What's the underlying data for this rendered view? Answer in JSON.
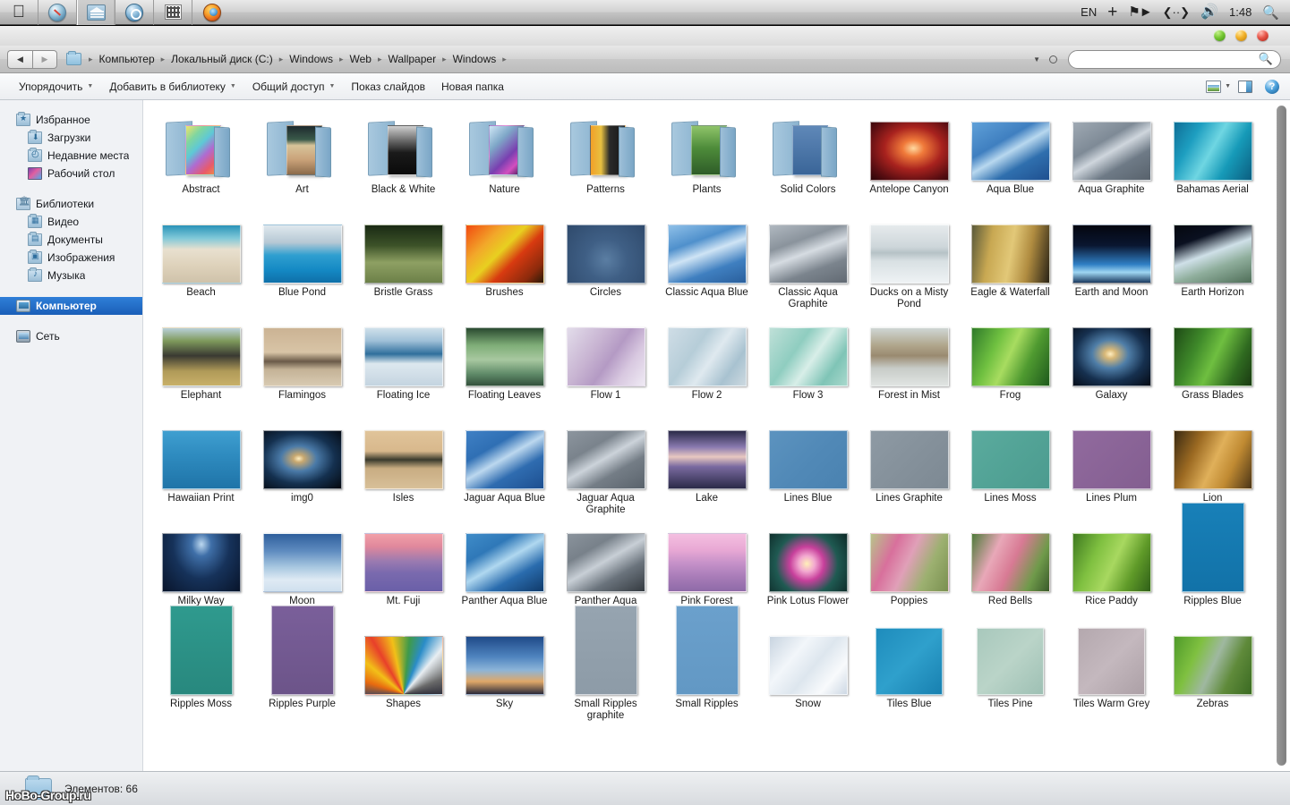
{
  "macbar": {
    "apps": [
      {
        "name": "apple-menu",
        "icon": "apple-icon"
      },
      {
        "name": "safari",
        "icon": "safari-icon"
      },
      {
        "name": "file-manager",
        "icon": "bank-folder-icon"
      },
      {
        "name": "spotlight-app",
        "icon": "blue-globe-icon"
      },
      {
        "name": "qr-app",
        "icon": "qr-code-icon"
      },
      {
        "name": "firefox",
        "icon": "firefox-icon"
      }
    ],
    "status": {
      "input_language": "EN",
      "plus": "+",
      "flag_icon": "flag-icon",
      "network_icon": "network-icon",
      "volume_icon": "volume-icon",
      "clock": "1:48",
      "search_icon": "magnifier-icon"
    }
  },
  "window": {
    "traffic_lights": [
      "green",
      "yellow",
      "red"
    ],
    "colors": {
      "selection": "#1a5fb8",
      "accent": "#2f7fd8"
    }
  },
  "address_bar": {
    "back_label": "◀",
    "forward_label": "▶",
    "folder_icon": "folder-icon",
    "breadcrumbs": [
      "Компьютер",
      "Локальный диск (C:)",
      "Windows",
      "Web",
      "Wallpaper",
      "Windows"
    ],
    "separator": "▸",
    "history_caret": "▼",
    "refresh_icon": "refresh-icon"
  },
  "search": {
    "value": "",
    "placeholder": "",
    "icon": "search-icon"
  },
  "command_bar": {
    "items": [
      {
        "label": "Упорядочить",
        "has_dropdown": true
      },
      {
        "label": "Добавить в библиотеку",
        "has_dropdown": true
      },
      {
        "label": "Общий доступ",
        "has_dropdown": true
      },
      {
        "label": "Показ слайдов",
        "has_dropdown": false
      },
      {
        "label": "Новая папка",
        "has_dropdown": false
      }
    ],
    "right_icons": [
      {
        "name": "change-view-icon"
      },
      {
        "name": "view-dropdown-caret",
        "glyph": "▼"
      },
      {
        "name": "preview-pane-icon"
      },
      {
        "name": "help-icon",
        "glyph": "?"
      }
    ]
  },
  "sidebar": {
    "groups": [
      {
        "header": {
          "label": "Избранное",
          "icon": "favorites-star-icon"
        },
        "items": [
          {
            "label": "Загрузки",
            "icon": "downloads-icon"
          },
          {
            "label": "Недавние места",
            "icon": "recent-places-icon"
          },
          {
            "label": "Рабочий стол",
            "icon": "desktop-icon"
          }
        ]
      },
      {
        "header": {
          "label": "Библиотеки",
          "icon": "libraries-icon"
        },
        "items": [
          {
            "label": "Видео",
            "icon": "video-library-icon"
          },
          {
            "label": "Документы",
            "icon": "documents-library-icon"
          },
          {
            "label": "Изображения",
            "icon": "pictures-library-icon"
          },
          {
            "label": "Музыка",
            "icon": "music-library-icon"
          }
        ]
      },
      {
        "header": {
          "label": "Компьютер",
          "icon": "computer-icon",
          "selected": true
        },
        "items": []
      },
      {
        "header": {
          "label": "Сеть",
          "icon": "network-icon"
        },
        "items": []
      }
    ]
  },
  "status_bar": {
    "icon": "folder-icon",
    "text": "Элементов: 66"
  },
  "watermark": "HoBo-Group.ru",
  "items": [
    {
      "name": "Abstract",
      "type": "folder",
      "thumb": "linear-gradient(135deg,#f0e36a 0%,#7fd6a0 22%,#5ec8d6 40%,#b06ad0 58%,#e85a6a 78%,#f2a03c 100%)"
    },
    {
      "name": "Art",
      "type": "folder",
      "thumb": "linear-gradient(to bottom,#1e2a2e 0%,#3a5a4a 28%,#d8c49a 40%,#c9a178 70%,#8a6a4a 100%)"
    },
    {
      "name": "Black & White",
      "type": "folder",
      "thumb": "linear-gradient(to bottom,#cfcfcf 0%,#6a6a6a 30%,#1a1a1a 55%,#0a0a0a 100%)"
    },
    {
      "name": "Nature",
      "type": "folder",
      "thumb": "linear-gradient(135deg,#cfe6f5 0%,#7fa8c8 30%,#7a3fb0 60%,#d24fc0 78%,#2a1040 100%)"
    },
    {
      "name": "Patterns",
      "type": "folder",
      "thumb": "linear-gradient(to right,#f2a028 0%,#e8c040 30%,#2a2a2a 55%,#151515 100%)"
    },
    {
      "name": "Plants",
      "type": "folder",
      "thumb": "linear-gradient(to bottom,#8fc46a 0%,#4e8c3a 45%,#2e5c28 100%)"
    },
    {
      "name": "Solid Colors",
      "type": "folder",
      "thumb": "linear-gradient(to bottom,#5f88b8,#3a6598)"
    },
    {
      "name": "Antelope Canyon",
      "type": "image",
      "thumb": "radial-gradient(ellipse at 55% 45%, #ffd9a0 0%, #f07a3a 18%, #a8221e 48%, #5a0e12 78%, #2a0508 100%)"
    },
    {
      "name": "Aqua Blue",
      "type": "image",
      "thumb": "linear-gradient(150deg,#5fa0d8 0%,#3f7fc0 35%,#b8d8ef 50%,#2f6fae 70%,#1f5090 100%)"
    },
    {
      "name": "Aqua Graphite",
      "type": "image",
      "thumb": "linear-gradient(150deg,#9fa9b3 0%,#7e8a96 35%,#cfd6dd 50%,#6e7a86 70%,#58626c 100%)"
    },
    {
      "name": "Bahamas Aerial",
      "type": "image",
      "thumb": "linear-gradient(120deg,#0f6e96 0%,#1d9ec0 25%,#6fd6e2 48%,#169ab8 70%,#0c5e80 100%)"
    },
    {
      "name": "Beach",
      "type": "image",
      "thumb": "linear-gradient(to bottom,#2a93b8 0%,#7fc8d8 22%,#e8e0cf 42%,#ded2bb 70%,#cfc2aa 100%)"
    },
    {
      "name": "Blue Pond",
      "type": "image",
      "thumb": "linear-gradient(to bottom,#dfe8ee 0%,#b6c8d4 30%,#2f9fd0 52%,#1489c4 78%,#0f6fa8 100%)"
    },
    {
      "name": "Bristle Grass",
      "type": "image",
      "thumb": "linear-gradient(to bottom,#1a2a14 0%,#3c5228 35%,#8ea063 65%,#6c8048 100%)"
    },
    {
      "name": "Brushes",
      "type": "image",
      "thumb": "linear-gradient(135deg,#f24a10 0%,#f2a82a 28%,#e8d020 45%,#d83a10 62%,#8c2a0c 85%,#2a1a08 100%)"
    },
    {
      "name": "Circles",
      "type": "image",
      "thumb": "radial-gradient(circle at 50% 60%, #5b7ea3 0%, #3f5f85 40%, #2f4a6c 100%)"
    },
    {
      "name": "Classic Aqua Blue",
      "type": "image",
      "thumb": "linear-gradient(160deg,#8fc0e8 0%,#4f90cc 30%,#cfe4f5 48%,#3f7fc0 72%,#2a5f9c 100%)"
    },
    {
      "name": "Classic Aqua Graphite",
      "type": "image",
      "thumb": "linear-gradient(160deg,#b0b8c0 0%,#8a939c 30%,#d6dce2 48%,#7b848d 72%,#626a73 100%)"
    },
    {
      "name": "Ducks on a Misty Pond",
      "type": "image",
      "thumb": "linear-gradient(to bottom,#e6eaec 0%,#cdd6da 38%,#b6c2c6 48%,#d8e0e3 62%,#eef2f4 100%)"
    },
    {
      "name": "Eagle & Waterfall",
      "type": "image",
      "thumb": "linear-gradient(100deg,#5a5a3a 0%,#c8a852 25%,#e2c878 50%,#b08c40 72%,#2a2416 100%)"
    },
    {
      "name": "Earth and Moon",
      "type": "image",
      "thumb": "linear-gradient(to bottom,#04060f 0%,#0a1630 35%,#2f7fc4 68%,#9fd6f2 82%,#1a3a60 100%)"
    },
    {
      "name": "Earth Horizon",
      "type": "image",
      "thumb": "linear-gradient(160deg,#05080f 0%,#0a1020 25%,#cfe0e8 48%,#8fae9c 68%,#4f6e58 100%)"
    },
    {
      "name": "Elephant",
      "type": "image",
      "thumb": "linear-gradient(to bottom,#b8cfd8 0%,#7f9a5c 22%,#3a3a32 48%,#b09a58 75%,#c8b068 100%)"
    },
    {
      "name": "Flamingos",
      "type": "image",
      "thumb": "linear-gradient(to bottom,#cbb394 0%,#d8c4a6 42%,#6a5a48 58%,#c4b296 72%,#d8cab2 100%)"
    },
    {
      "name": "Floating Ice",
      "type": "image",
      "thumb": "linear-gradient(to bottom,#cfe0ea 0%,#9fc0d8 22%,#2f6f9c 45%,#dde8ef 62%,#c4d4e0 100%)"
    },
    {
      "name": "Floating Leaves",
      "type": "image",
      "thumb": "linear-gradient(to bottom,#2a4a30 0%,#7fae78 30%,#a8c8a0 55%,#5f8a68 80%,#33513c 100%)"
    },
    {
      "name": "Flow 1",
      "type": "image",
      "thumb": "linear-gradient(125deg,#e2dcea 0%,#c8b4d2 35%,#b49ac4 55%,#d8c8e0 75%,#efeaf4 100%)"
    },
    {
      "name": "Flow 2",
      "type": "image",
      "thumb": "linear-gradient(125deg,#cfdde6 0%,#b6cdd8 35%,#dfe9ef 55%,#a8c2d0 78%,#cdd9e0 100%)"
    },
    {
      "name": "Flow 3",
      "type": "image",
      "thumb": "linear-gradient(125deg,#bfe0d8 0%,#8fcdc0 35%,#d8eee8 55%,#7fc4b6 78%,#a8d8cc 100%)"
    },
    {
      "name": "Forest in Mist",
      "type": "image",
      "thumb": "linear-gradient(to bottom,#cfd6d4 0%,#b0a68c 30%,#9a8a70 48%,#c8ccc8 70%,#e0e4e2 100%)"
    },
    {
      "name": "Frog",
      "type": "image",
      "thumb": "linear-gradient(115deg,#2f7a2a 0%,#6fc040 30%,#a8dc60 48%,#4f9a30 70%,#1e5a1c 100%)"
    },
    {
      "name": "Galaxy",
      "type": "image",
      "thumb": "radial-gradient(ellipse at 48% 45%, #ffeec0 0%, #d8b878 10%, #4f7ea8 32%, #16304f 62%, #050a14 100%)"
    },
    {
      "name": "Grass Blades",
      "type": "image",
      "thumb": "linear-gradient(115deg,#1e4a16 0%,#3f8a2a 30%,#6fbf40 52%,#2f6a20 78%,#1a3a12 100%)"
    },
    {
      "name": "Hawaiian Print",
      "type": "image",
      "thumb": "linear-gradient(to bottom,#3f9fd0 0%,#2f8cc0 40%,#1f74a8 100%)"
    },
    {
      "name": "img0",
      "type": "image",
      "thumb": "radial-gradient(ellipse at 45% 48%, #ffeec0 0%, #c8a870 9%, #4a7aa8 30%, #14304f 60%, #04080f 100%)"
    },
    {
      "name": "Isles",
      "type": "image",
      "thumb": "linear-gradient(to bottom,#e0c49a 0%,#d8b88c 35%,#3a3a2c 50%,#c8ac82 65%,#d8c098 100%)"
    },
    {
      "name": "Jaguar Aqua Blue",
      "type": "image",
      "thumb": "linear-gradient(150deg,#3f80c4 0%,#2f6fb4 30%,#bcd8ef 48%,#2f6cb0 68%,#1d4f90 100%)"
    },
    {
      "name": "Jaguar Aqua Graphite",
      "type": "image",
      "thumb": "linear-gradient(150deg,#8c959e 0%,#7a838c 30%,#ccd3da 48%,#747d86 68%,#5a636c 100%)"
    },
    {
      "name": "Lake",
      "type": "image",
      "thumb": "linear-gradient(to bottom,#2a2a48 0%,#8a7ab0 28%,#e8c8c0 45%,#7a6aa0 62%,#2a2a48 100%)"
    },
    {
      "name": "Lines Blue",
      "type": "image",
      "thumb": "linear-gradient(135deg,#5c93bf 0%,#5189b7 50%,#4a82b0 100%)"
    },
    {
      "name": "Lines Graphite",
      "type": "image",
      "thumb": "linear-gradient(135deg,#8e9aa4 0%,#85919b 50%,#7d8993 100%)"
    },
    {
      "name": "Lines Moss",
      "type": "image",
      "thumb": "linear-gradient(135deg,#5bab9e 0%,#52a396 50%,#4c9b8f 100%)"
    },
    {
      "name": "Lines Plum",
      "type": "image",
      "thumb": "linear-gradient(135deg,#916a9e 0%,#8a6497 50%,#835e90 100%)"
    },
    {
      "name": "Lion",
      "type": "image",
      "thumb": "linear-gradient(115deg,#3a2a12 0%,#9c6a22 28%,#e0b05a 52%,#c08a32 72%,#4a3416 100%)"
    },
    {
      "name": "Milky Way",
      "type": "image",
      "thumb": "radial-gradient(ellipse at 50% 18%, #bcd8f0 0%, #3f6fa8 18%, #16325a 52%, #08142a 100%)"
    },
    {
      "name": "Moon",
      "type": "image",
      "thumb": "linear-gradient(to bottom,#2f5f9c 0%,#5f8cc0 30%,#a8c8e0 58%,#dfeaf4 80%,#cfe0ee 100%)"
    },
    {
      "name": "Mt. Fuji",
      "type": "image",
      "thumb": "linear-gradient(to bottom,#f2a0a8 0%,#e0889c 22%,#9a7ab0 48%,#7a6aae 68%,#6a5fa8 100%)"
    },
    {
      "name": "Panther Aqua Blue",
      "type": "image",
      "thumb": "linear-gradient(150deg,#3f8cc8 0%,#2f78b8 28%,#b0d8f0 48%,#2a6cae 70%,#103a6a 100%)"
    },
    {
      "name": "Panther Aqua Graphite",
      "type": "image",
      "thumb": "linear-gradient(150deg,#8a939c 0%,#78818a 28%,#c8cfd6 48%,#6a737c 70%,#343a40 100%)"
    },
    {
      "name": "Pink Forest",
      "type": "image",
      "thumb": "linear-gradient(to bottom,#f4bfe0 0%,#e8a8d4 28%,#c490c8 52%,#a87cb8 75%,#8e6aa8 100%)"
    },
    {
      "name": "Pink Lotus Flower",
      "type": "image",
      "thumb": "radial-gradient(circle at 48% 52%, #fff0b8 0%, #f2a8d0 16%, #c8409c 34%, #1f5a52 62%, #0e2a28 100%)"
    },
    {
      "name": "Poppies",
      "type": "image",
      "thumb": "linear-gradient(115deg,#b8c48a 0%,#d8709c 28%,#e0a0b8 48%,#9cb070 72%,#7a9050 100%)"
    },
    {
      "name": "Red Bells",
      "type": "image",
      "thumb": "linear-gradient(115deg,#4f7a3a 0%,#e8a8b8 30%,#d87a94 52%,#6f9a4a 78%,#3a5a2a 100%)"
    },
    {
      "name": "Rice Paddy",
      "type": "image",
      "thumb": "linear-gradient(115deg,#3f7a20 0%,#7fc040 30%,#a8d860 52%,#5f9a28 75%,#2f5f18 100%)"
    },
    {
      "name": "Ripples Blue",
      "type": "image",
      "shape": "tall",
      "thumb": "linear-gradient(to bottom,#1880b8,#1272a8)"
    },
    {
      "name": "Ripples Moss",
      "type": "image",
      "shape": "tall",
      "thumb": "linear-gradient(to bottom,#2f9a8e,#28887e)"
    },
    {
      "name": "Ripples Purple",
      "type": "image",
      "shape": "tall",
      "thumb": "linear-gradient(to bottom,#7a5f9a,#6c5489)"
    },
    {
      "name": "Shapes",
      "type": "image",
      "thumb": "conic-gradient(from 200deg at 50% 100%, #2a2a4a 0deg, #2e7a3a 30deg, #1f4070 62deg, #e86a10 88deg, #f2c018 110deg, #e8402a 130deg, #f2c018 148deg, #3f9a4a 166deg, #2a8cc8 182deg, #e8eef2 200deg, #6a6a6a 228deg, #1a1a2a 260deg, #2a2a4a 360deg)"
    },
    {
      "name": "Sky",
      "type": "image",
      "thumb": "linear-gradient(to bottom,#1f4a88 0%,#4f84bf 35%,#8cb4d8 58%,#e0a868 78%,#2a2a3a 100%)"
    },
    {
      "name": "Small Ripples graphite",
      "type": "image",
      "shape": "tall",
      "thumb": "linear-gradient(to bottom,#96a4b0,#8d9ba7)"
    },
    {
      "name": "Small Ripples",
      "type": "image",
      "shape": "tall",
      "thumb": "linear-gradient(to bottom,#6ba0cc,#6298c4)"
    },
    {
      "name": "Snow",
      "type": "image",
      "thumb": "linear-gradient(130deg,#c8d4e0 0%,#f2f6fa 32%,#dde6ee 55%,#f8fafc 78%,#cdd8e4 100%)"
    },
    {
      "name": "Tiles Blue",
      "type": "image",
      "shape": "square",
      "thumb": "linear-gradient(135deg,#1e8cbc,#2fa0cc 50%,#1880b0)"
    },
    {
      "name": "Tiles Pine",
      "type": "image",
      "shape": "square",
      "thumb": "linear-gradient(135deg,#a8c8bc,#bad4c8 50%,#9ec0b4)"
    },
    {
      "name": "Tiles Warm Grey",
      "type": "image",
      "shape": "square",
      "thumb": "linear-gradient(135deg,#b4a8ae,#c4b8be 50%,#aca0a6)"
    },
    {
      "name": "Zebras",
      "type": "image",
      "thumb": "linear-gradient(115deg,#4f9a2a 0%,#7fc040 28%,#9fb8a0 50%,#5f8a3a 72%,#3a6a22 100%)"
    }
  ]
}
